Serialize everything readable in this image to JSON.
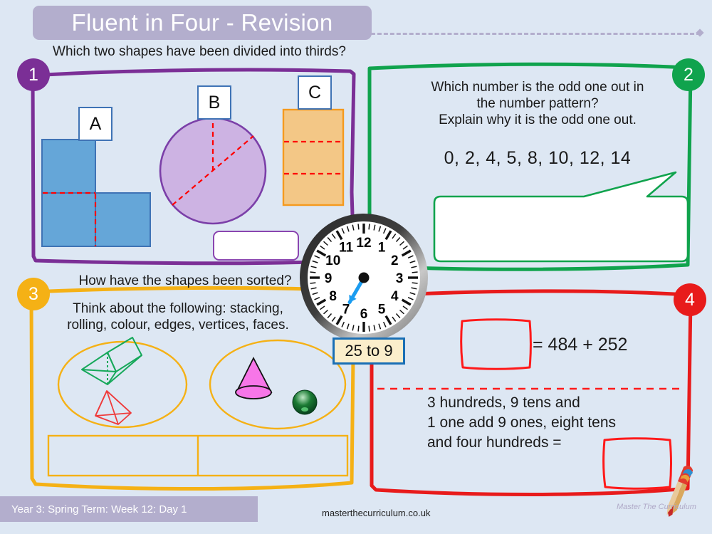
{
  "header": {
    "title": "Fluent in Four - Revision"
  },
  "questions": [
    {
      "number": "1",
      "accent": "#7b2f96",
      "prompt": "Which two shapes have been divided into thirds?",
      "shape_labels": [
        "A",
        "B",
        "C"
      ],
      "shapes": [
        {
          "name": "L-shape",
          "label": "A",
          "fill": "#65a6d8",
          "stroke": "#3f73b5",
          "divider": "#ff0000",
          "parts": 3
        },
        {
          "name": "circle",
          "label": "B",
          "fill": "#cdb3e3",
          "stroke": "#7b3fa8",
          "divider": "#ff0000",
          "parts": 3
        },
        {
          "name": "rectangle",
          "label": "C",
          "fill": "#f3c786",
          "stroke": "#f59a1e",
          "divider": "#ff0000",
          "parts": 3
        }
      ],
      "answer_box": ""
    },
    {
      "number": "2",
      "accent": "#10a34d",
      "prompt_line1": "Which number is the odd one out in",
      "prompt_line2": "the number pattern?",
      "prompt_line3": "Explain why it is the odd one out.",
      "sequence": "0,  2,  4,  5,  8,  10,  12,  14",
      "answer_box": ""
    },
    {
      "number": "3",
      "accent": "#f5b115",
      "prompt": "How have the shapes been sorted?",
      "subprompt_line1": "Think about the following: stacking,",
      "subprompt_line2": "rolling, colour, edges, vertices, faces.",
      "sets": [
        {
          "name": "left-set",
          "shapes": [
            "triangular-prism",
            "square-pyramid"
          ]
        },
        {
          "name": "right-set",
          "shapes": [
            "cone",
            "sphere"
          ]
        }
      ],
      "answer_cells": [
        "",
        ""
      ]
    },
    {
      "number": "4",
      "accent": "#e81b1b",
      "equation": "= 484 + 252",
      "equation_box": "",
      "words_line1": "3 hundreds, 9 tens and",
      "words_line2": "1 one add 9 ones, eight tens",
      "words_line3": "and four hundreds =",
      "words_box": ""
    }
  ],
  "clock": {
    "numerals": [
      "12",
      "1",
      "2",
      "3",
      "4",
      "5",
      "6",
      "7",
      "8",
      "9",
      "10",
      "11"
    ],
    "hand_color": "#1b9cf0",
    "time_label": "25 to 9"
  },
  "footer": {
    "lesson": "Year 3: Spring Term: Week 12: Day 1",
    "url": "masterthecurriculum.co.uk",
    "brand": "Master The Curriculum"
  }
}
